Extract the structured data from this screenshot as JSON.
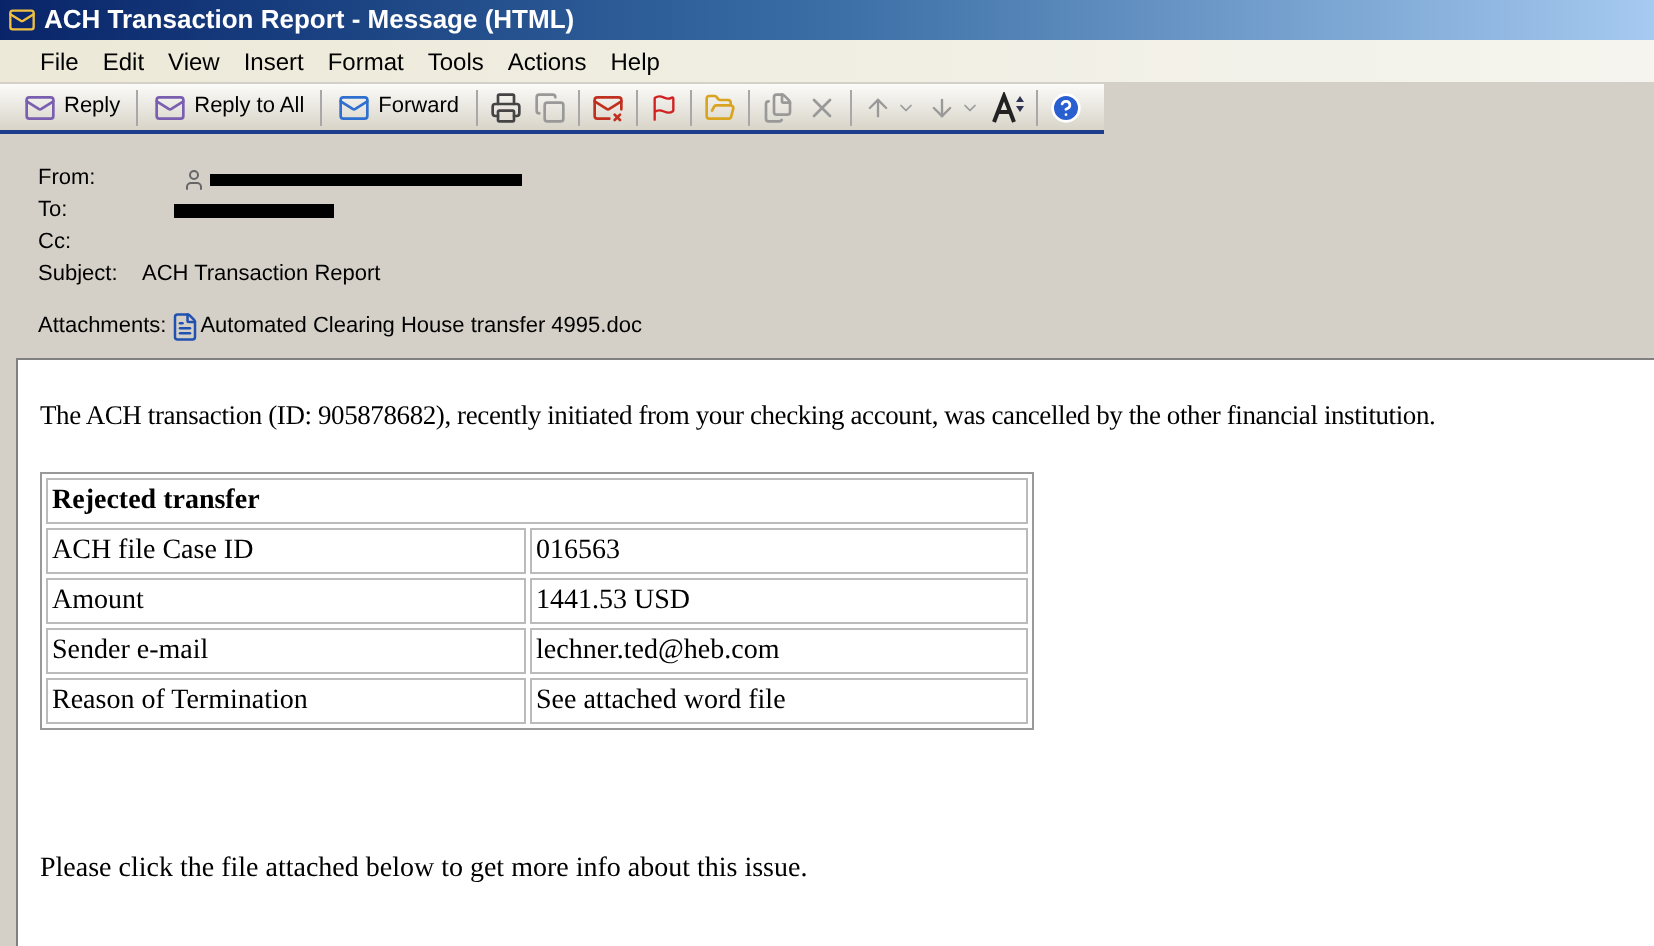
{
  "window": {
    "title": "ACH Transaction Report - Message (HTML)"
  },
  "menu": [
    "File",
    "Edit",
    "View",
    "Insert",
    "Format",
    "Tools",
    "Actions",
    "Help"
  ],
  "toolbar": [
    {
      "kind": "reply",
      "label": "Reply"
    },
    {
      "kind": "reply_all",
      "label": "Reply to All"
    },
    {
      "kind": "forward",
      "label": "Forward"
    }
  ],
  "header": {
    "fields": [
      {
        "label": "From:",
        "kind": "sender"
      },
      {
        "label": "To:",
        "kind": "redacted"
      },
      {
        "label": "Cc:",
        "kind": "empty"
      },
      {
        "label": "Subject:",
        "kind": "text",
        "value": "ACH Transaction Report"
      }
    ],
    "attachments": {
      "label": "Attachments:",
      "file": "Automated Clearing House transfer 4995.doc"
    }
  },
  "body": {
    "intro": "The ACH transaction (ID: 905878682), recently initiated from your checking account, was cancelled by the other financial institution.",
    "table": {
      "title": "Rejected transfer",
      "rows": [
        [
          "ACH file Case ID",
          "016563"
        ],
        [
          "Amount",
          "1441.53 USD"
        ],
        [
          "Sender e-mail",
          "lechner.ted@heb.com"
        ],
        [
          "Reason of Termination",
          "See attached word file"
        ]
      ]
    },
    "closing": "Please click the file attached below to get more info about this issue."
  }
}
